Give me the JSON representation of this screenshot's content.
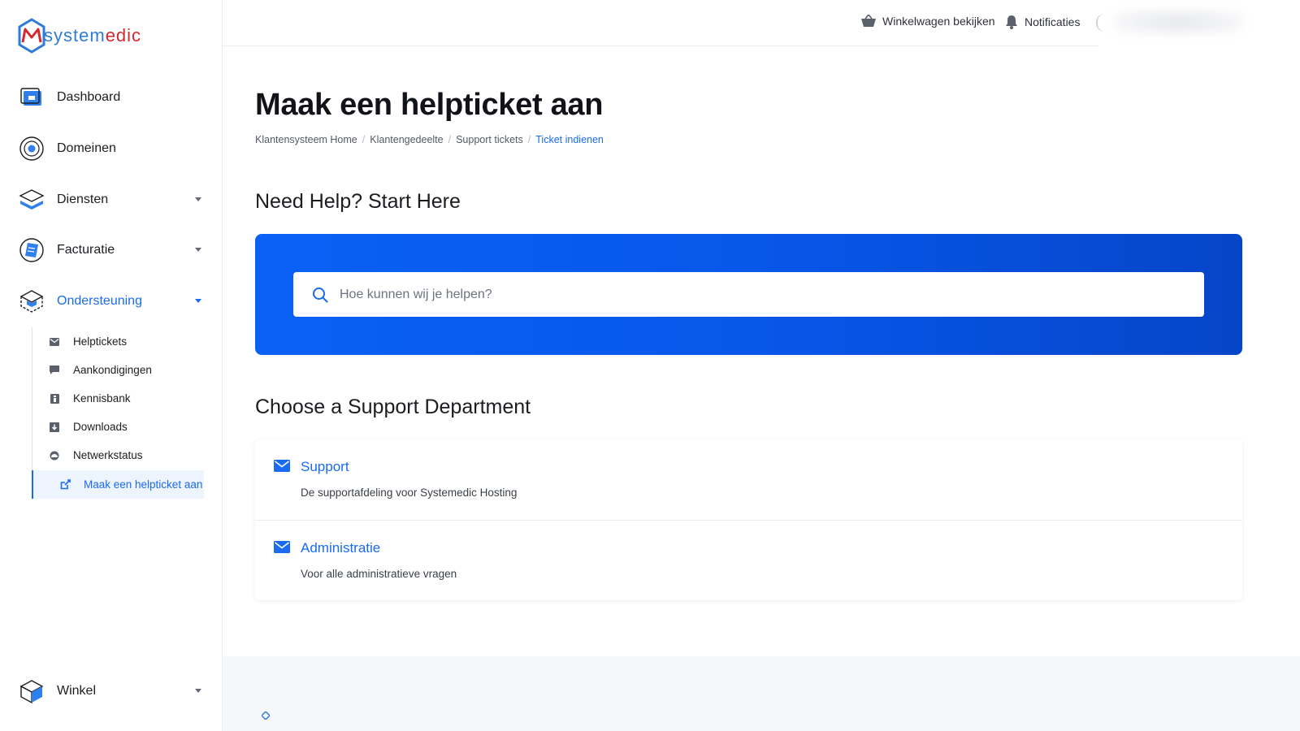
{
  "brand": {
    "part1": "system",
    "part2": "edic",
    "prefix": "M"
  },
  "sidebar": {
    "items": [
      {
        "label": "Dashboard",
        "icon": "dashboard-icon"
      },
      {
        "label": "Domeinen",
        "icon": "globe-icon"
      },
      {
        "label": "Diensten",
        "icon": "layers-icon"
      },
      {
        "label": "Facturatie",
        "icon": "invoice-icon"
      },
      {
        "label": "Ondersteuning",
        "icon": "support-box-icon"
      }
    ],
    "support_sub": [
      {
        "label": "Helptickets",
        "icon": "envelope-icon"
      },
      {
        "label": "Aankondigingen",
        "icon": "comment-icon"
      },
      {
        "label": "Kennisbank",
        "icon": "book-icon"
      },
      {
        "label": "Downloads",
        "icon": "download-icon"
      },
      {
        "label": "Netwerkstatus",
        "icon": "status-icon"
      },
      {
        "label": "Maak een helpticket aan",
        "icon": "external-link-icon"
      }
    ],
    "bottom": {
      "label": "Winkel",
      "icon": "cube-icon"
    }
  },
  "topbar": {
    "cart": "Winkelwagen bekijken",
    "notifications": "Notificaties"
  },
  "page": {
    "title": "Maak een helpticket aan",
    "breadcrumb": [
      "Klantensysteem Home",
      "Klantengedeelte",
      "Support tickets",
      "Ticket indienen"
    ]
  },
  "help": {
    "title": "Need Help? Start Here",
    "search_placeholder": "Hoe kunnen wij je helpen?",
    "search_value": ""
  },
  "departments": {
    "title": "Choose a Support Department",
    "items": [
      {
        "name": "Support",
        "desc": "De supportafdeling voor Systemedic Hosting"
      },
      {
        "name": "Administratie",
        "desc": "Voor alle administratieve vragen"
      }
    ]
  },
  "colors": {
    "accent": "#1a6bf0",
    "hero_start": "#0a61f5",
    "hero_end": "#0545c8",
    "brand_blue": "#2f7bd8",
    "brand_red": "#d8262e"
  }
}
